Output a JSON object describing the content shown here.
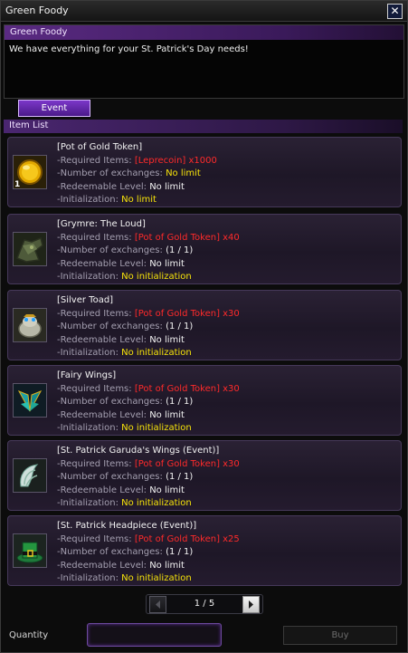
{
  "window": {
    "title": "Green Foody"
  },
  "npc": {
    "name": "Green Foody",
    "greeting": "We have everything for your St. Patrick's Day needs!"
  },
  "tabs": {
    "event_label": "Event"
  },
  "list": {
    "header": "Item List"
  },
  "labels": {
    "required": "-Required Items: ",
    "exchanges": "-Number of exchanges: ",
    "level": "-Redeemable Level: ",
    "init": "-Initialization: "
  },
  "items": [
    {
      "name": "[Pot of Gold Token]",
      "required": "[Leprecoin] x1000",
      "exchanges": "No limit",
      "level": "No limit",
      "init": "No limit",
      "qty": "1",
      "icon": "gold-coin-icon"
    },
    {
      "name": "[Grymre: The Loud]",
      "required": "[Pot of Gold Token] x40",
      "exchanges": "(1 / 1)",
      "level": "No limit",
      "init": "No initialization",
      "qty": "",
      "icon": "grymre-icon"
    },
    {
      "name": "[Silver Toad]",
      "required": "[Pot of Gold Token] x30",
      "exchanges": "(1 / 1)",
      "level": "No limit",
      "init": "No initialization",
      "qty": "",
      "icon": "silver-toad-icon"
    },
    {
      "name": "[Fairy Wings]",
      "required": "[Pot of Gold Token] x30",
      "exchanges": "(1 / 1)",
      "level": "No limit",
      "init": "No initialization",
      "qty": "",
      "icon": "fairy-wings-icon"
    },
    {
      "name": "[St. Patrick Garuda's Wings (Event)]",
      "required": "[Pot of Gold Token] x30",
      "exchanges": "(1 / 1)",
      "level": "No limit",
      "init": "No initialization",
      "qty": "",
      "icon": "garuda-wings-icon"
    },
    {
      "name": "[St. Patrick Headpiece (Event)]",
      "required": "[Pot of Gold Token] x25",
      "exchanges": "(1 / 1)",
      "level": "No limit",
      "init": "No initialization",
      "qty": "",
      "icon": "green-hat-icon"
    }
  ],
  "pager": {
    "text": "1 / 5"
  },
  "footer": {
    "quantity_label": "Quantity",
    "quantity_value": "",
    "buy_label": "Buy"
  }
}
